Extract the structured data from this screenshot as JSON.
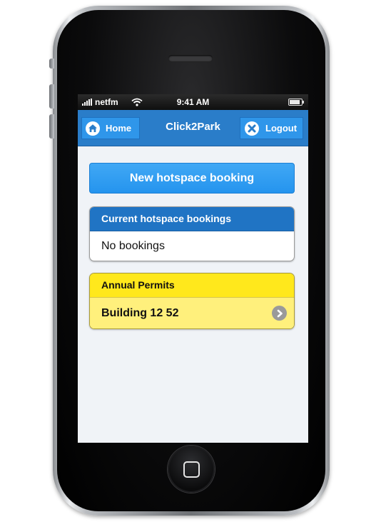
{
  "status_bar": {
    "carrier": "netfm",
    "time": "9:41 AM"
  },
  "header": {
    "title": "Click2Park",
    "home_label": "Home",
    "logout_label": "Logout"
  },
  "main": {
    "new_booking_button": "New hotspace booking",
    "current_bookings": {
      "title": "Current hotspace bookings",
      "empty_text": "No bookings"
    },
    "annual_permits": {
      "title": "Annual Permits",
      "items": [
        {
          "label": "Building 12 52"
        }
      ]
    }
  },
  "colors": {
    "header": "#2a7dc9",
    "button": "#2f96ea",
    "permits_header": "#ffe81c",
    "permits_row": "#fff07c"
  }
}
